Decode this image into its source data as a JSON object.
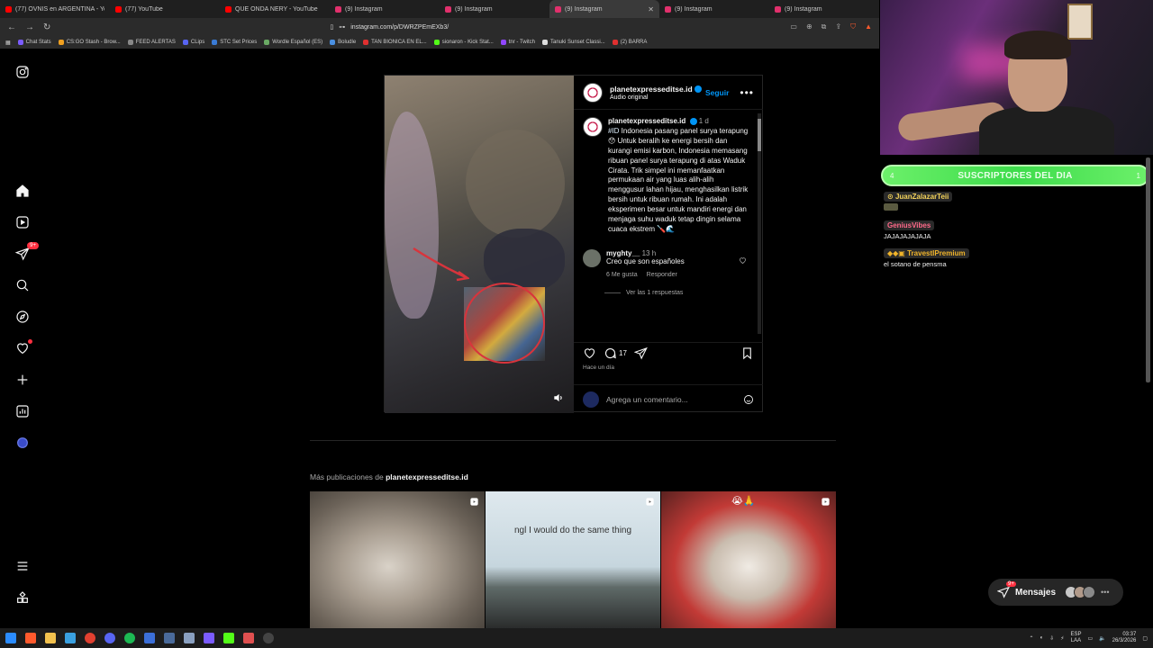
{
  "browser": {
    "tabs": [
      {
        "title": "(77) OVNIS en ARGENTINA - YouTub",
        "color": "#ff0000",
        "active": false
      },
      {
        "title": "(77) YouTube",
        "color": "#ff0000",
        "active": false
      },
      {
        "title": "QUE ONDA ÑERY - YouTube",
        "color": "#ff0000",
        "active": false
      },
      {
        "title": "(9) Instagram",
        "color": "#e1306c",
        "active": false
      },
      {
        "title": "(9) Instagram",
        "color": "#e1306c",
        "active": false
      },
      {
        "title": "(9) Instagram",
        "color": "#e1306c",
        "active": true
      },
      {
        "title": "(9) Instagram",
        "color": "#e1306c",
        "active": false
      },
      {
        "title": "(9) Instagram",
        "color": "#e1306c",
        "active": false
      }
    ],
    "url": "instagram.com/p/DWRZPEmEXb3/",
    "bookmarks": [
      {
        "label": "Chat Stats",
        "color": "#7b5cff"
      },
      {
        "label": "CS:GO Stash - Brow...",
        "color": "#f0a020"
      },
      {
        "label": "FEED ALERTAS",
        "color": "#888888"
      },
      {
        "label": "CLips",
        "color": "#5865f2"
      },
      {
        "label": "STC Set Prices",
        "color": "#3a7bd5"
      },
      {
        "label": "Wordle Español (ES)",
        "color": "#6aaa64"
      },
      {
        "label": "Boludle",
        "color": "#4a90e2"
      },
      {
        "label": "TAN BIONICA EN EL...",
        "color": "#e03030"
      },
      {
        "label": "sionaron - Kick Stat...",
        "color": "#53fc18"
      },
      {
        "label": "tnr - Twitch",
        "color": "#9146ff"
      },
      {
        "label": "Tanuki Sunset Classi...",
        "color": "#dddddd"
      },
      {
        "label": "(2) BARRA",
        "color": "#e03030"
      }
    ]
  },
  "nav": {
    "notifications_badge": "9+"
  },
  "post": {
    "username": "planetexpresseditse.id",
    "audio": "Audio original",
    "follow_label": "Seguir",
    "caption_time": "1 d",
    "hashtag": "#ID",
    "caption_text": " Indonesia pasang panel surya terapung 😯 Untuk beralih ke energi bersih dan kurangi emisi karbon, Indonesia memasang ribuan panel surya terapung di atas Waduk Cirata. Trik simpel ini memanfaatkan permukaan air yang luas alih-alih menggusur lahan hijau, menghasilkan listrik bersih untuk ribuan rumah. Ini adalah eksperimen besar untuk mandiri energi dan menjaga suhu waduk tetap dingin selama cuaca ekstrem 🪛🌊",
    "comment": {
      "username": "myghty__",
      "time": "13 h",
      "text": "Creo que son españoles",
      "likes": "6 Me gusta",
      "reply_label": "Responder",
      "view_replies": "Ver las 1 respuestas"
    },
    "comment_count": "17",
    "posted_ago": "Hace un día",
    "comment_placeholder": "Agrega un comentario..."
  },
  "more": {
    "prefix": "Más publicaciones de ",
    "username": "planetexpresseditse.id",
    "thumb2_caption": "ngl I would do the same thing",
    "thumb3_emojis": "😭🙏"
  },
  "messages": {
    "label": "Mensajes",
    "badge": "9+"
  },
  "overlay": {
    "subs_title": "SUSCRIPTORES DEL DIA",
    "subs_left": "4",
    "subs_right": "1",
    "chat": [
      {
        "user": "JuanZalazarTeii",
        "color": "#f3d25a",
        "message": ""
      },
      {
        "user": "GeniusVibes",
        "color": "#ff6a8a",
        "message": "JAJAJAJAJAJA"
      },
      {
        "user": "TravestIPremium",
        "color": "#f0b42a",
        "message": "el sotano de pensma"
      }
    ]
  },
  "taskbar": {
    "lang_top": "ESP",
    "lang_bottom": "LAA",
    "time": "03:37",
    "date": "26/3/2026"
  }
}
